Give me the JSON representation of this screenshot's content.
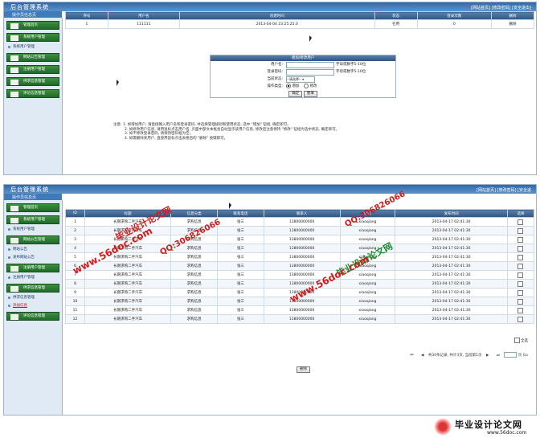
{
  "top": {
    "logo": "后台管理系统",
    "sub": "操作员信息页",
    "links": "[网站首页] [修改密码] [安全退出]",
    "links2": "[网站首页] [修改密码] [安全退"
  },
  "sidebar1": {
    "items": [
      {
        "label": "管理首页",
        "type": "btn"
      },
      {
        "label": "系统用户管理",
        "type": "btn"
      },
      {
        "label": "系统用户管理",
        "type": "link"
      },
      {
        "label": "网站公告管理",
        "type": "btn"
      },
      {
        "label": "注册用户管理",
        "type": "btn"
      },
      {
        "label": "供求信息管理",
        "type": "btn"
      },
      {
        "label": "评论信息管理",
        "type": "btn"
      }
    ]
  },
  "sidebar2": {
    "items": [
      {
        "label": "管理首页",
        "type": "btn"
      },
      {
        "label": "系统用户管理",
        "type": "btn"
      },
      {
        "label": "系统用户管理",
        "type": "link"
      },
      {
        "label": "网站公告管理",
        "type": "btn"
      },
      {
        "label": "网站公告",
        "type": "link"
      },
      {
        "label": "发布网站公告",
        "type": "link"
      },
      {
        "label": "注册用户管理",
        "type": "btn"
      },
      {
        "label": "注册用户管理",
        "type": "link"
      },
      {
        "label": "供求信息管理",
        "type": "btn"
      },
      {
        "label": "供求信息管理",
        "type": "link"
      },
      {
        "label": "添加信息",
        "type": "link",
        "red": true
      },
      {
        "label": "评论信息管理",
        "type": "btn"
      }
    ]
  },
  "user_table": {
    "headers": [
      "序号",
      "用户名",
      "创建时间",
      "状态",
      "登录次数",
      "删除"
    ],
    "rows": [
      [
        "1",
        "111111",
        "2013-04-04 23:25:25.0",
        "在用",
        "0",
        "删除"
      ]
    ]
  },
  "form": {
    "title": "增加/修改用户",
    "username_label": "用户名:",
    "username_hint": "字母或数字5-10位",
    "password_label": "登录密码:",
    "password_hint": "字母或数字5-10位",
    "status_label": "当前状态:",
    "status_value": "--请选择--",
    "op_label": "操作类型:",
    "op_add": "增加",
    "op_edit": "修改",
    "submit": "确定",
    "reset": "重填"
  },
  "notes": [
    "注意: 1. 如增加用户, 请直接输入用户名和登录密码, 并选择管理级别和使用状态, 选中 \"增加\" 钮组, 确定即可。",
    "2. 如修改用户信息, 请用鼠标点击用户名, 页面中部文本框会自动显示该用户信息, 修改后注意保持 \"修改\" 钮组为选中状态, 确定即可。",
    "3. 如不修改登录密码, 请保持密码框为空。",
    "4. 如需删除某用户, 直接用鼠标点击表格后的 \"删除\" 按键即可。"
  ],
  "info_table": {
    "headers": [
      "ID",
      "标题",
      "信息分类",
      "联系电话",
      "联系人",
      "会员",
      "发布时间",
      "选择"
    ],
    "rows": [
      [
        "1",
        "长期求购二手汽车",
        "求购信息",
        "张三",
        "13800000000",
        "xiaoqiang",
        "2013-04-17 02:41:30"
      ],
      [
        "2",
        "长期求购二手汽车",
        "求购信息",
        "张三",
        "13800000000",
        "xiaoqiang",
        "2013-04-17 02:41:30"
      ],
      [
        "3",
        "长期求购二手汽车",
        "求购信息",
        "张三",
        "13800000000",
        "xiaoqiang",
        "2013-04-17 02:41:30"
      ],
      [
        "4",
        "长期求购二手汽车",
        "求购信息",
        "张三",
        "13800000000",
        "xiaoqiang",
        "2013-04-17 02:41:30"
      ],
      [
        "5",
        "长期求购二手汽车",
        "求购信息",
        "张三",
        "13800000000",
        "xiaoqiang",
        "2013-04-17 02:41:30"
      ],
      [
        "6",
        "长期求购二手汽车",
        "求购信息",
        "张三",
        "13800000000",
        "xiaoqiang",
        "2013-04-17 02:41:30"
      ],
      [
        "7",
        "长期求购二手汽车",
        "求购信息",
        "张三",
        "13800000000",
        "xiaoqiang",
        "2013-04-17 02:41:30"
      ],
      [
        "8",
        "长期求购二手汽车",
        "求购信息",
        "张三",
        "13800000000",
        "xiaoqiang",
        "2013-04-17 02:41:30"
      ],
      [
        "9",
        "长期求购二手汽车",
        "求购信息",
        "张三",
        "13800000000",
        "xiaoqiang",
        "2013-04-17 02:41:30"
      ],
      [
        "10",
        "长期求购二手汽车",
        "求购信息",
        "张三",
        "13800000000",
        "xiaoqiang",
        "2013-04-17 02:41:30"
      ],
      [
        "11",
        "长期求购二手汽车",
        "求购信息",
        "张三",
        "13800000000",
        "xiaoqiang",
        "2013-04-17 02:41:30"
      ],
      [
        "12",
        "长期求购二手汽车",
        "求购信息",
        "张三",
        "13800000000",
        "xiaoqiang",
        "2013-04-17 02:41:30"
      ]
    ],
    "select_all": "全选",
    "pager_text": "共30条记录, 共计3页, 当前第1页",
    "pager_page_suffix": "页",
    "pager_go": "Go",
    "delete": "删除"
  },
  "watermarks": {
    "w1": "毕业设计论文网",
    "w2": "www.56doc.com",
    "w3": "QQ:306826066"
  },
  "footer": {
    "brand": "毕业设计论文网",
    "url": "www.56doc.com"
  },
  "colors": {
    "header": "#2f6aa8",
    "sidebar": "#dfeaf5",
    "button_green": "#2d7a34",
    "watermark_red": "#d21a1a",
    "watermark_green": "#1a8a2a"
  }
}
